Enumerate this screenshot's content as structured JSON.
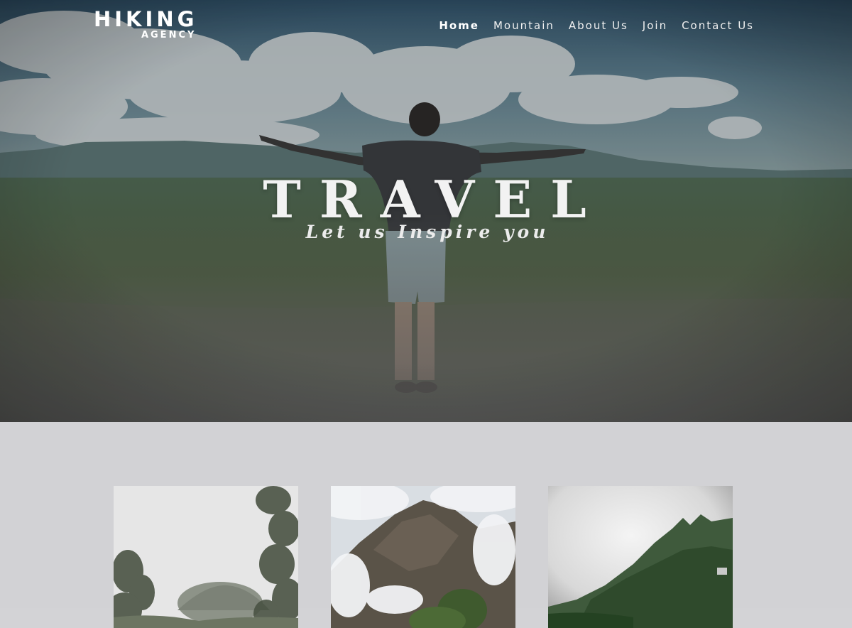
{
  "brand": {
    "name": "HIKING",
    "tagline": "AGENCY"
  },
  "nav": {
    "items": [
      {
        "label": "Home",
        "active": true
      },
      {
        "label": "Mountain",
        "active": false
      },
      {
        "label": "About Us",
        "active": false
      },
      {
        "label": "Join",
        "active": false
      },
      {
        "label": "Contact Us",
        "active": false
      }
    ]
  },
  "hero": {
    "title": "TRAVEL",
    "subtitle": "Let us Inspire you"
  },
  "gallery": {
    "cards": [
      {
        "image": "misty-forest-hill-photo"
      },
      {
        "image": "cloudy-mountain-peak-photo"
      },
      {
        "image": "green-mountain-ridge-photo"
      }
    ]
  },
  "colors": {
    "text": "#ffffff",
    "section_background": "#d2d2d5"
  }
}
